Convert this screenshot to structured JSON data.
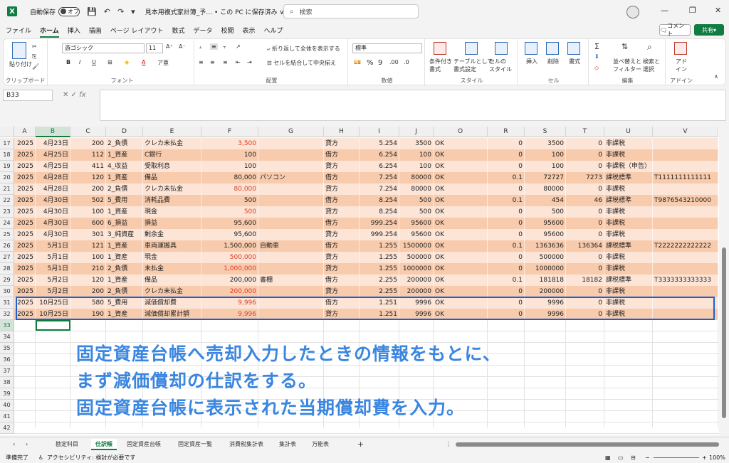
{
  "titlebar": {
    "autosave_label": "自動保存",
    "autosave_state": "オフ",
    "doc_title": "見本用複式家計簿_予… • この PC に保存済み ∨",
    "search_placeholder": "検索"
  },
  "menu": [
    "ファイル",
    "ホーム",
    "挿入",
    "描画",
    "ページ レイアウト",
    "数式",
    "データ",
    "校閲",
    "表示",
    "ヘルプ"
  ],
  "menu_active": "ホーム",
  "comment_label": "コメント",
  "share_label": "共有",
  "ribbon": {
    "paste": "貼り付け",
    "clipboard": "クリップボード",
    "font_name": "游ゴシック",
    "font_size": "11",
    "font_group": "フォント",
    "wrap": "折り返して全体を表示する",
    "merge": "セルを結合して中央揃え",
    "align_group": "配置",
    "number_format": "標準",
    "number_group": "数値",
    "cond_format": "条件付き\n書式",
    "table_format": "テーブルとして\n書式設定",
    "cell_style": "セルの\nスタイル",
    "style_group": "スタイル",
    "insert": "挿入",
    "delete": "削除",
    "format": "書式",
    "cells_group": "セル",
    "sort": "並べ替えと\nフィルター",
    "find": "検索と\n選択",
    "edit_group": "編集",
    "addin": "アド\nイン",
    "addin_group": "アドイン"
  },
  "formula_bar": {
    "cell_ref": "B33",
    "fx": "fx",
    "value": ""
  },
  "columns": [
    "A",
    "B",
    "C",
    "D",
    "E",
    "F",
    "G",
    "H",
    "I",
    "J",
    "O",
    "R",
    "S",
    "T",
    "U",
    "V"
  ],
  "rows": [
    {
      "n": "17",
      "a": "2025",
      "b": "4月23日",
      "c": "200",
      "d": "2_負債",
      "e": "クレカ未払金",
      "f": "3,500",
      "f_red": true,
      "g": "",
      "h": "貸方",
      "i": "5.254",
      "j": "3500",
      "o": "OK",
      "r": "0",
      "s": "3500",
      "t": "0",
      "u": "非課税",
      "v": ""
    },
    {
      "n": "18",
      "a": "2025",
      "b": "4月25日",
      "c": "112",
      "d": "1_資産",
      "e": "C銀行",
      "f": "100",
      "f_red": false,
      "g": "",
      "h": "借方",
      "i": "6.254",
      "j": "100",
      "o": "OK",
      "r": "0",
      "s": "100",
      "t": "0",
      "u": "非課税",
      "v": ""
    },
    {
      "n": "19",
      "a": "2025",
      "b": "4月25日",
      "c": "411",
      "d": "4_収益",
      "e": "受取利息",
      "f": "100",
      "f_red": false,
      "g": "",
      "h": "貸方",
      "i": "6.254",
      "j": "100",
      "o": "OK",
      "r": "0",
      "s": "100",
      "t": "0",
      "u": "非課税（申告）",
      "v": ""
    },
    {
      "n": "20",
      "a": "2025",
      "b": "4月28日",
      "c": "120",
      "d": "1_資産",
      "e": "備品",
      "f": "80,000",
      "f_red": false,
      "g": "パソコン",
      "h": "借方",
      "i": "7.254",
      "j": "80000",
      "o": "OK",
      "r": "0.1",
      "s": "72727",
      "t": "7273",
      "u": "課税標準",
      "v": "T1111111111111"
    },
    {
      "n": "21",
      "a": "2025",
      "b": "4月28日",
      "c": "200",
      "d": "2_負債",
      "e": "クレカ未払金",
      "f": "80,000",
      "f_red": true,
      "g": "",
      "h": "貸方",
      "i": "7.254",
      "j": "80000",
      "o": "OK",
      "r": "0",
      "s": "80000",
      "t": "0",
      "u": "非課税",
      "v": ""
    },
    {
      "n": "22",
      "a": "2025",
      "b": "4月30日",
      "c": "502",
      "d": "5_費用",
      "e": "消耗品費",
      "f": "500",
      "f_red": false,
      "g": "",
      "h": "借方",
      "i": "8.254",
      "j": "500",
      "o": "OK",
      "r": "0.1",
      "s": "454",
      "t": "46",
      "u": "課税標準",
      "v": "T9876543210000"
    },
    {
      "n": "23",
      "a": "2025",
      "b": "4月30日",
      "c": "100",
      "d": "1_資産",
      "e": "現金",
      "f": "500",
      "f_red": true,
      "g": "",
      "h": "貸方",
      "i": "8.254",
      "j": "500",
      "o": "OK",
      "r": "0",
      "s": "500",
      "t": "0",
      "u": "非課税",
      "v": ""
    },
    {
      "n": "24",
      "a": "2025",
      "b": "4月30日",
      "c": "600",
      "d": "6_損益",
      "e": "損益",
      "f": "95,600",
      "f_red": false,
      "g": "",
      "h": "借方",
      "i": "999.254",
      "j": "95600",
      "o": "OK",
      "r": "0",
      "s": "95600",
      "t": "0",
      "u": "非課税",
      "v": ""
    },
    {
      "n": "25",
      "a": "2025",
      "b": "4月30日",
      "c": "301",
      "d": "3_純資産",
      "e": "剰余金",
      "f": "95,600",
      "f_red": false,
      "g": "",
      "h": "貸方",
      "i": "999.254",
      "j": "95600",
      "o": "OK",
      "r": "0",
      "s": "95600",
      "t": "0",
      "u": "非課税",
      "v": ""
    },
    {
      "n": "26",
      "a": "2025",
      "b": "5月1日",
      "c": "121",
      "d": "1_資産",
      "e": "車両運搬具",
      "f": "1,500,000",
      "f_red": false,
      "g": "自動車",
      "h": "借方",
      "i": "1.255",
      "j": "1500000",
      "o": "OK",
      "r": "0.1",
      "s": "1363636",
      "t": "136364",
      "u": "課税標準",
      "v": "T2222222222222"
    },
    {
      "n": "27",
      "a": "2025",
      "b": "5月1日",
      "c": "100",
      "d": "1_資産",
      "e": "現金",
      "f": "500,000",
      "f_red": true,
      "g": "",
      "h": "貸方",
      "i": "1.255",
      "j": "500000",
      "o": "OK",
      "r": "0",
      "s": "500000",
      "t": "0",
      "u": "非課税",
      "v": ""
    },
    {
      "n": "28",
      "a": "2025",
      "b": "5月1日",
      "c": "210",
      "d": "2_負債",
      "e": "未払金",
      "f": "1,000,000",
      "f_red": true,
      "g": "",
      "h": "貸方",
      "i": "1.255",
      "j": "1000000",
      "o": "OK",
      "r": "0",
      "s": "1000000",
      "t": "0",
      "u": "非課税",
      "v": ""
    },
    {
      "n": "29",
      "a": "2025",
      "b": "5月2日",
      "c": "120",
      "d": "1_資産",
      "e": "備品",
      "f": "200,000",
      "f_red": false,
      "g": "書棚",
      "h": "借方",
      "i": "2.255",
      "j": "200000",
      "o": "OK",
      "r": "0.1",
      "s": "181818",
      "t": "18182",
      "u": "課税標準",
      "v": "T3333333333333"
    },
    {
      "n": "30",
      "a": "2025",
      "b": "5月2日",
      "c": "200",
      "d": "2_負債",
      "e": "クレカ未払金",
      "f": "200,000",
      "f_red": true,
      "g": "",
      "h": "貸方",
      "i": "2.255",
      "j": "200000",
      "o": "OK",
      "r": "0",
      "s": "200000",
      "t": "0",
      "u": "非課税",
      "v": ""
    },
    {
      "n": "31",
      "a": "2025",
      "b": "10月25日",
      "c": "580",
      "d": "5_費用",
      "e": "減価償却費",
      "f": "9,996",
      "f_red": true,
      "g": "",
      "h": "借方",
      "i": "1.251",
      "j": "9996",
      "o": "OK",
      "r": "0",
      "s": "9996",
      "t": "0",
      "u": "非課税",
      "v": ""
    },
    {
      "n": "32",
      "a": "2025",
      "b": "10月25日",
      "c": "190",
      "d": "1_資産",
      "e": "減価償却累計額",
      "f": "9,996",
      "f_red": true,
      "g": "",
      "h": "貸方",
      "i": "1.251",
      "j": "9996",
      "o": "OK",
      "r": "0",
      "s": "9996",
      "t": "0",
      "u": "非課税",
      "v": ""
    }
  ],
  "empty_rows": [
    "33",
    "34",
    "35",
    "36",
    "37",
    "38",
    "39",
    "40",
    "41",
    "42"
  ],
  "annotation": [
    "固定資産台帳へ売却入力したときの情報をもとに、",
    "まず減価償却の仕訳をする。",
    "固定資産台帳に表示された当期償却費を入力。"
  ],
  "sheet_tabs": [
    "勘定科目",
    "仕訳帳",
    "固定資産台帳",
    "固定資産一覧",
    "消費税集計表",
    "集計表",
    "万能表"
  ],
  "active_tab": "仕訳帳",
  "status": {
    "ready": "準備完了",
    "accessibility": "アクセシビリティ: 検討が必要です",
    "zoom": "100%"
  }
}
